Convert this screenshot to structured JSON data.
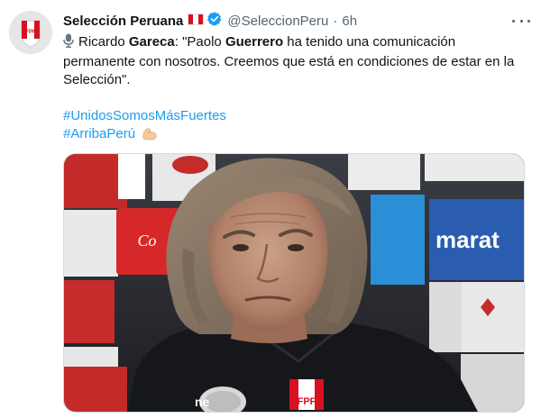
{
  "account": {
    "display_name": "Selección Peruana",
    "flag_icon": "peru-flag-icon",
    "verified_icon": "verified-badge-icon",
    "handle": "@SeleccionPeru",
    "separator": "·",
    "time": "6h",
    "avatar_letters": "FPF"
  },
  "tweet": {
    "mic_icon": "microphone-icon",
    "segments": [
      {
        "t": "Ricardo ",
        "b": false
      },
      {
        "t": "Gareca",
        "b": true
      },
      {
        "t": ": \"Paolo ",
        "b": false
      },
      {
        "t": "Guerrero",
        "b": true
      },
      {
        "t": " ha tenido una comunicación permanente con nosotros. Creemos que está en condiciones de estar en la Selección\".",
        "b": false
      }
    ],
    "hashtags": [
      "#UnidosSomosMásFuertes",
      "#ArribaPerú"
    ],
    "flexed_biceps_icon": "flexed-biceps-icon"
  },
  "media": {
    "sponsor_text_1": "marat",
    "jersey_letters": "FPF"
  },
  "colors": {
    "link": "#1d9bf0",
    "text": "#0f1419",
    "muted": "#536471",
    "peru_red": "#d91023",
    "sponsor_blue": "#2a5db0",
    "verified_blue": "#1d9bf0"
  }
}
